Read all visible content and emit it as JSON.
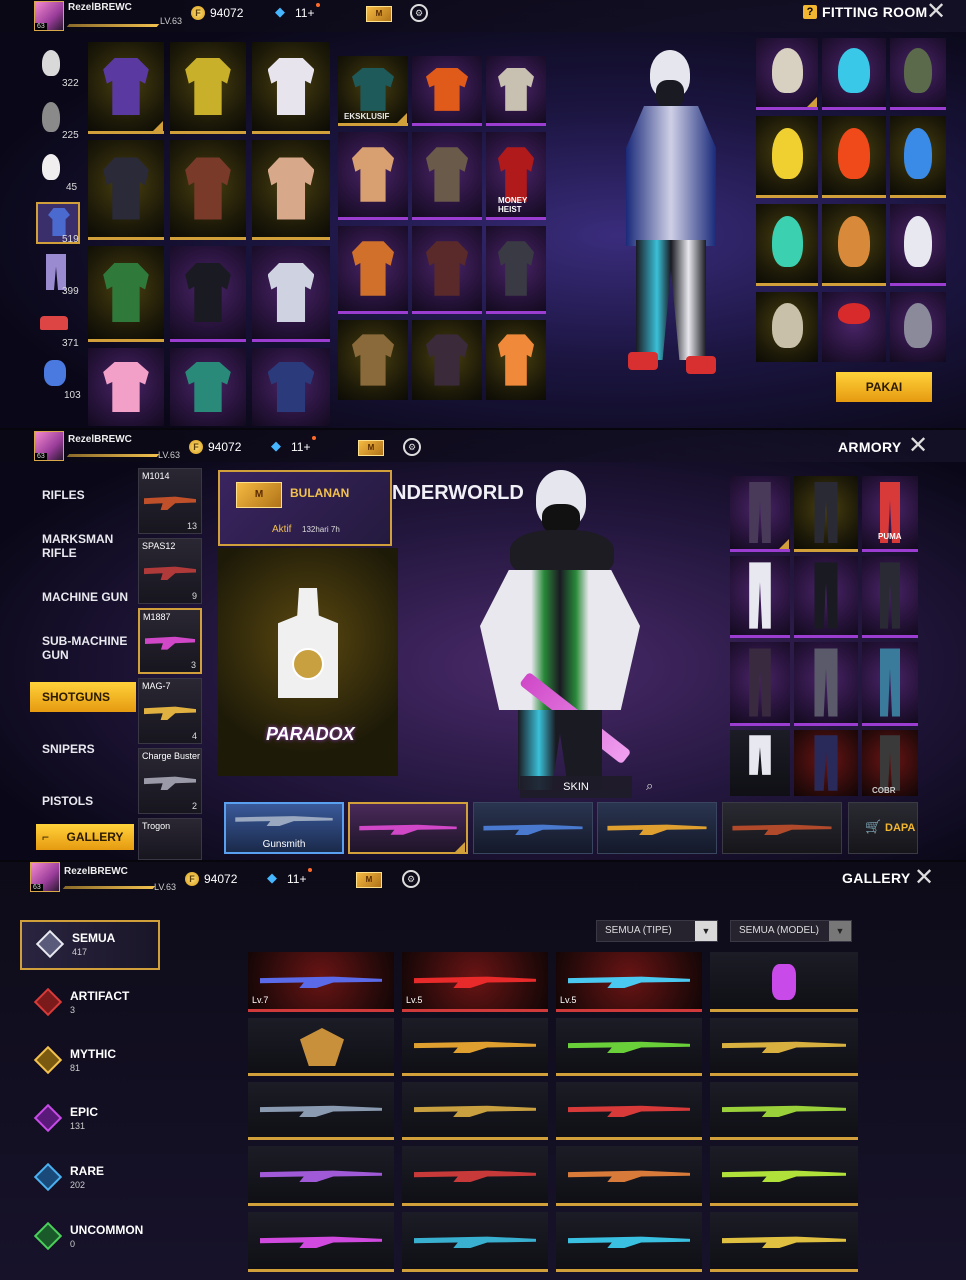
{
  "player": {
    "name": "RezelBREWC",
    "level_label": "LV.63",
    "level_badge": "63",
    "coins": "94072",
    "diamonds": "11+"
  },
  "panels": {
    "fitting_room": {
      "title": "FITTING ROOM",
      "help": "?",
      "confirm_label": "PAKAI",
      "categories": [
        {
          "count": "322"
        },
        {
          "count": "225"
        },
        {
          "count": "45"
        },
        {
          "count": "519"
        },
        {
          "count": "399"
        },
        {
          "count": "371"
        },
        {
          "count": "103"
        }
      ],
      "tile_labels": {
        "eksklusif": "EKSKLUSIF",
        "money_heist": "MONEY HEIST"
      }
    },
    "armory": {
      "title": "ARMORY",
      "weapon_title": "NDERWORLD",
      "categories": [
        "RIFLES",
        "MARKSMAN RIFLE",
        "MACHINE GUN",
        "SUB-MACHINE GUN",
        "SHOTGUNS",
        "SNIPERS",
        "PISTOLS"
      ],
      "selected_category": "SHOTGUNS",
      "gallery_label": "GALLERY",
      "weapons": [
        {
          "name": "M1014",
          "count": "13"
        },
        {
          "name": "SPAS12",
          "count": "9"
        },
        {
          "name": "M1887",
          "count": "3"
        },
        {
          "name": "MAG-7",
          "count": "4"
        },
        {
          "name": "Charge Buster",
          "count": "2"
        },
        {
          "name": "Trogon",
          "count": ""
        }
      ],
      "membership": {
        "title": "BULANAN",
        "status": "Aktif",
        "remaining": "132hari 7h"
      },
      "brand": "PARADOX",
      "skin_label": "SKIN",
      "first_skin": "Gunsmith",
      "dapat_label": "DAPA",
      "puma_label": "PUMA",
      "cobra_label": "COBR"
    },
    "gallery": {
      "title": "GALLERY",
      "filters": [
        "SEMUA (TIPE)",
        "SEMUA (MODEL)"
      ],
      "rarities": [
        {
          "name": "SEMUA",
          "count": "417"
        },
        {
          "name": "ARTIFACT",
          "count": "3"
        },
        {
          "name": "MYTHIC",
          "count": "81"
        },
        {
          "name": "EPIC",
          "count": "131"
        },
        {
          "name": "RARE",
          "count": "202"
        },
        {
          "name": "UNCOMMON",
          "count": "0"
        }
      ],
      "levels": [
        "Lv.7",
        "Lv.5",
        "Lv.5"
      ]
    }
  },
  "colors": {
    "gold": "#d1a03a",
    "purple": "#9b3dd1",
    "red": "#d13a3a",
    "yellow_button": "#ffc21a"
  }
}
